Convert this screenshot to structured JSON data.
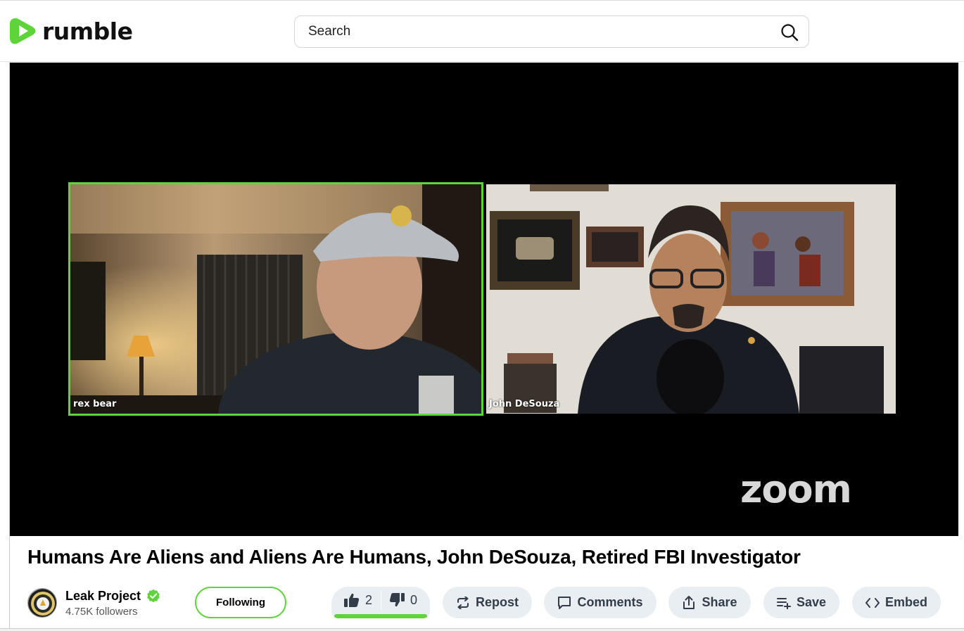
{
  "header": {
    "logo_text": "rumble",
    "logo_icon": "rumble-play-icon",
    "search": {
      "placeholder": "Search",
      "value": ""
    },
    "search_icon": "search-icon"
  },
  "player": {
    "participants": [
      {
        "name": "rex bear",
        "active_speaker": true
      },
      {
        "name": "John DeSouza",
        "active_speaker": false
      }
    ],
    "watermark": "zoom"
  },
  "video": {
    "title": "Humans Are Aliens and Aliens Are Humans, John DeSouza, Retired FBI Investigator"
  },
  "channel": {
    "name": "Leak Project",
    "verified": true,
    "followers": "4.75K followers",
    "follow_label": "Following"
  },
  "actions": {
    "likes": "2",
    "dislikes": "0",
    "like_ratio": 1.0,
    "repost": "Repost",
    "comments": "Comments",
    "share": "Share",
    "save": "Save",
    "embed": "Embed"
  },
  "colors": {
    "brand_green": "#5fd33a",
    "pill_bg": "#e9eef3",
    "pill_text": "#333d4a"
  }
}
